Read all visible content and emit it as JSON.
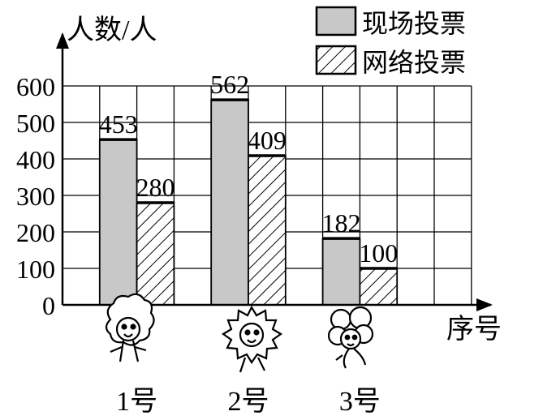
{
  "chart_data": {
    "type": "bar",
    "title": "",
    "ylabel": "人数/人",
    "xlabel": "序号",
    "ylim": [
      0,
      600
    ],
    "yticks": [
      0,
      100,
      200,
      300,
      400,
      500,
      600
    ],
    "grid": true,
    "legend_position": "top-right",
    "categories": [
      "1号",
      "2号",
      "3号"
    ],
    "series": [
      {
        "name": "现场投票",
        "values": [
          453,
          562,
          182
        ],
        "fill": "#c8c8c8",
        "pattern": "solid"
      },
      {
        "name": "网络投票",
        "values": [
          280,
          409,
          100
        ],
        "fill": "#ffffff",
        "pattern": "diagonal-hatch"
      }
    ],
    "data_labels": true,
    "category_icons": [
      "flower-mascot-icon",
      "sun-mascot-icon",
      "clover-mascot-icon"
    ]
  }
}
